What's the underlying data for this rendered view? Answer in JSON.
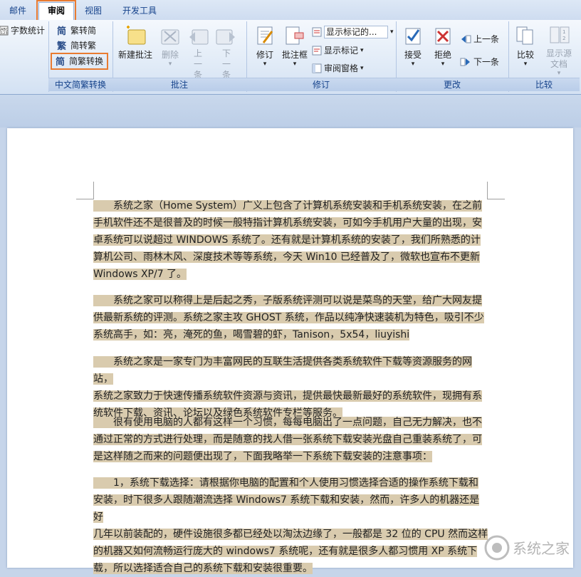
{
  "tabs": [
    {
      "label": "邮件",
      "active": false
    },
    {
      "label": "审阅",
      "active": true
    },
    {
      "label": "视图",
      "active": false
    },
    {
      "label": "开发工具",
      "active": false
    }
  ],
  "ribbon": {
    "proofing": {
      "word_count": "字数统计"
    },
    "chinese_conversion": {
      "to_traditional": "繁转简",
      "to_simplified": "简转繁",
      "convert": "简繁转换",
      "group_label": "中文简繁转换"
    },
    "comments": {
      "new": "新建批注",
      "delete": "删除",
      "previous": "上一条",
      "next": "下一条",
      "group_label": "批注"
    },
    "tracking": {
      "track_changes": "修订",
      "balloons": "批注框",
      "display_dropdown": "显示标记的...",
      "show_markup": "显示标记",
      "reviewing_pane": "审阅窗格",
      "group_label": "修订"
    },
    "changes": {
      "accept": "接受",
      "reject": "拒绝",
      "previous": "上一条",
      "next": "下一条",
      "group_label": "更改"
    },
    "compare": {
      "compare": "比较",
      "show_source": "显示源文档",
      "group_label": "比较"
    }
  },
  "document": {
    "paragraphs": [
      [
        "系统之家（Home System）广义上包含了计算机系统安装和手机系统安装，在之前",
        "手机软件还不是很普及的时候一般特指计算机系统安装，可如今手机用户大量的出现，安",
        "卓系统可以说超过 WINDOWS 系统了。还有就是计算机系统的安装了，我们所熟悉的计",
        "算机公司、雨林木风、深度技术等等系统，今天 Win10 已经普及了，微软也宣布不更新",
        "Windows XP/7 了。"
      ],
      [
        "系统之家可以称得上是后起之秀，子版系统评测可以说是菜鸟的天堂，给广大网友提",
        "供最新系统的评测。系统之家主攻 GHOST 系统，作品以纯净快速装机为特色，吸引不少",
        "系统高手，如：亮，淹死的鱼，喝雪碧的虾，Tanison，5x54，liuyishi"
      ],
      [
        "系统之家是一家专门为丰富网民的互联生活提供各类系统软件下载等资源服务的网站，",
        "系统之家致力于快速传播系统软件资源与资讯，提供最快最新最好的系统软件，现拥有系",
        "统软件下载、资讯、论坛以及绿色系统软件专栏等服务。"
      ],
      [
        "很有使用电脑的人都有这样一个习惯，每每电脑出了一点问题，自己无力解决，也不",
        "通过正常的方式进行处理，而是随意的找人借一张系统下载安装光盘自己重装系统了，可",
        "是这样随之而来的问题便出现了，下面我略举一下系统下载安装的注意事项："
      ],
      [
        "1，系统下载选择：请根据你电脑的配置和个人使用习惯选择合适的操作系统下载和",
        "安装，时下很多人跟随潮流选择 Windows7 系统下载和安装，然而，许多人的机器还是好",
        "几年以前装配的，硬件设施很多都已经处以淘汰边缘了，一般都是 32 位的 CPU 然而这样",
        "的机器又如何流畅运行庞大的 windows7 系统呢，还有就是很多人都习惯用 XP 系统下",
        "载，所以选择适合自己的系统下载和安装很重要。"
      ]
    ]
  },
  "watermark": "系统之家"
}
